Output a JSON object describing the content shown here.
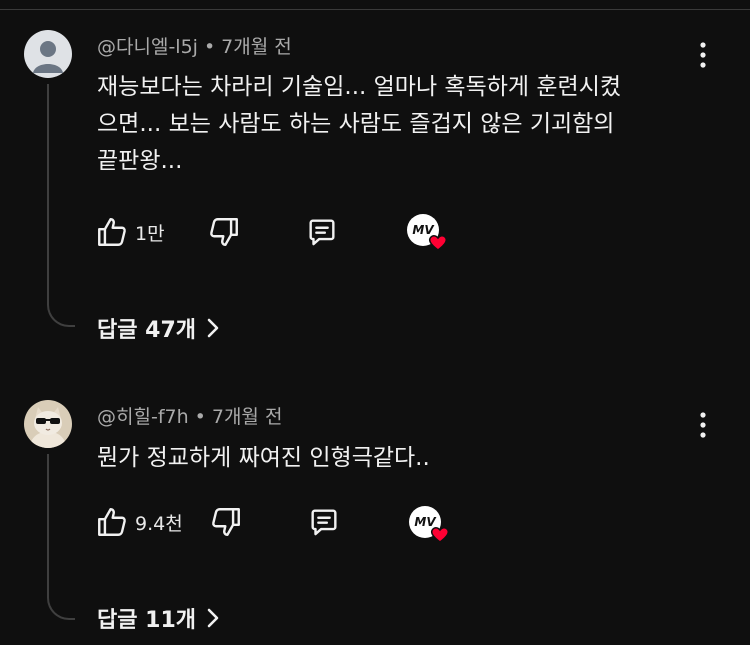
{
  "comments": [
    {
      "handle": "@다니엘-l5j",
      "separator": "•",
      "time": "7개월 전",
      "text": "재능보다는 차라리 기술임... 얼마나 혹독하게 훈련시켰\n으면... 보는 사람도 하는 사람도 즐겁지 않은 기괴함의\n끝판왕...",
      "likes": "1만",
      "replies_label": "답글 47개",
      "avatar": "default-user-avatar"
    },
    {
      "handle": "@히힐-f7h",
      "separator": "•",
      "time": "7개월 전",
      "text": "뭔가 정교하게 짜여진 인형극같다..",
      "likes": "9.4천",
      "replies_label": "답글 11개",
      "avatar": "cat-with-sunglasses-avatar"
    }
  ],
  "icons": {
    "like": "thumbs-up-icon",
    "dislike": "thumbs-down-icon",
    "reply": "reply-comment-icon",
    "more": "more-vertical-icon",
    "creator_heart": "creator-heart-badge",
    "chevron": "chevron-right-icon"
  },
  "colors": {
    "background": "#0f0f0f",
    "text": "#f1f1f1",
    "meta": "#aaaaaa",
    "heart": "#ff0033"
  }
}
